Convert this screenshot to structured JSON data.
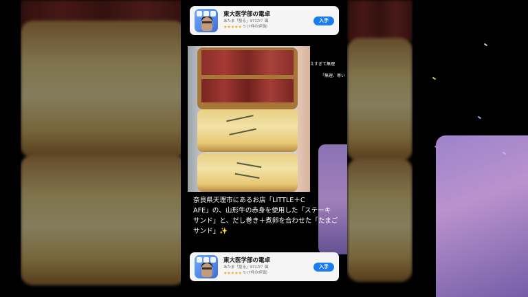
{
  "ad": {
    "app_title": "東大医学部の電卓",
    "subtitle": "あたま「割る」971か？図",
    "rating_text": "5 (7件の評価)",
    "get_label": "入手"
  },
  "photo": {
    "overlay_1": "えすぎて無理",
    "overlay_2": "「無理、尊い"
  },
  "caption": {
    "lines": [
      "奈良県天理市にあるお店「LITTLE＋C",
      "AFE」の、山形牛の赤身を使用した「ステーキ",
      "サンド」と、だし巻き＋煮卵を合わせた「たまご",
      "サンド」✨"
    ]
  },
  "colors": {
    "get_button": "#1a7cf0",
    "ad_background": "#f5f5f5",
    "accent_purple": "#a58ad6"
  },
  "icons": {
    "app_icon": "calculator-doctor-icon",
    "star": "star-icon"
  }
}
